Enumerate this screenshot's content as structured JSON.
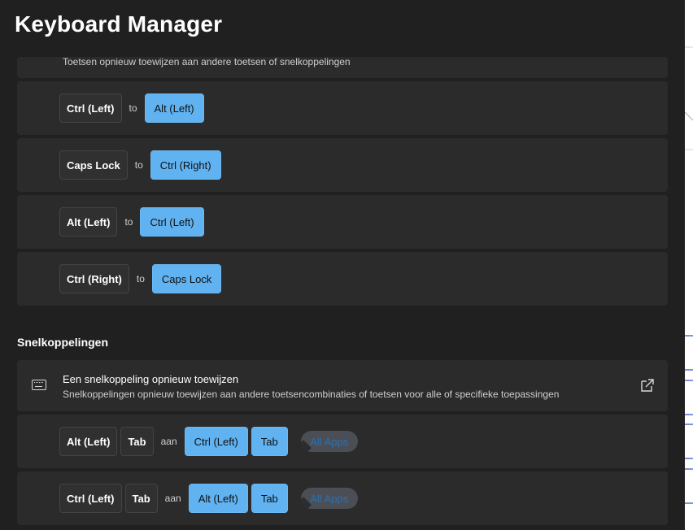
{
  "app": {
    "title": "Keyboard Manager"
  },
  "top_clip": {
    "desc": "Toetsen opnieuw toewijzen aan andere toetsen of snelkoppelingen"
  },
  "key_mappings": [
    {
      "from": "Ctrl (Left)",
      "sep": "to",
      "to": "Alt (Left)"
    },
    {
      "from": "Caps Lock",
      "sep": "to",
      "to": "Ctrl (Right)"
    },
    {
      "from": "Alt (Left)",
      "sep": "to",
      "to": "Ctrl (Left)"
    },
    {
      "from": "Ctrl (Right)",
      "sep": "to",
      "to": "Caps Lock"
    }
  ],
  "shortcuts_section": {
    "header": "Snelkoppelingen",
    "card_title": "Een snelkoppeling opnieuw toewijzen",
    "card_desc": "Snelkoppelingen opnieuw toewijzen aan andere toetsencombinaties of toetsen voor alle of specifieke toepassingen",
    "icons": {
      "leading": "keyboard-icon",
      "trailing": "open-external-icon"
    }
  },
  "shortcut_mappings": [
    {
      "from": [
        "Alt (Left)",
        "Tab"
      ],
      "sep": "aan",
      "to": [
        "Ctrl (Left)",
        "Tab"
      ],
      "app": "All Apps"
    },
    {
      "from": [
        "Ctrl (Left)",
        "Tab"
      ],
      "sep": "aan",
      "to": [
        "Alt (Left)",
        "Tab"
      ],
      "app": "All Apps"
    }
  ],
  "colors": {
    "background": "#202020",
    "card": "#2b2b2b",
    "accent_key": "#60b2f0",
    "pill": "#4b4f55"
  }
}
